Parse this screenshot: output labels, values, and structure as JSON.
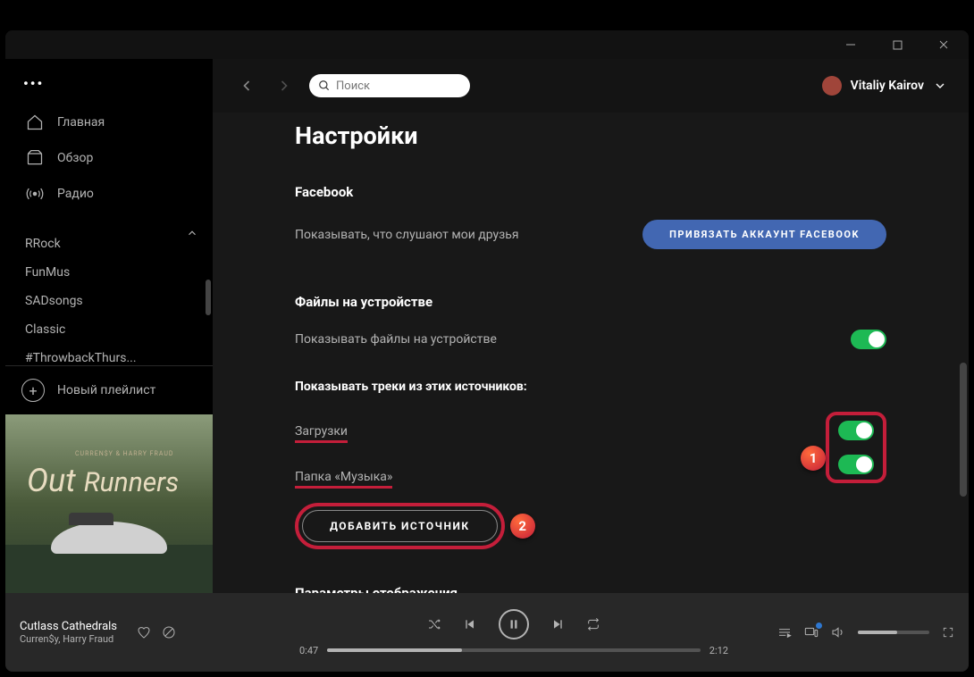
{
  "window": {
    "minimize": "−",
    "maximize": "☐",
    "close": "✕"
  },
  "search": {
    "placeholder": "Поиск"
  },
  "user": {
    "name": "Vitaliy Kairov"
  },
  "nav": {
    "more": "•••",
    "home": "Главная",
    "browse": "Обзор",
    "radio": "Радио"
  },
  "playlists": [
    "RRock",
    "FunMus",
    "SADsongs",
    "Classic",
    "#ThrowbackThurs..."
  ],
  "newPlaylist": "Новый плейлист",
  "album": {
    "topline": "CURREN$Y & HARRY FRAUD",
    "title_a": "Out",
    "title_b": "Runners"
  },
  "settings": {
    "title": "Настройки",
    "facebook": {
      "heading": "Facebook",
      "desc": "Показывать, что слушают мои друзья",
      "button": "ПРИВЯЗАТЬ АККАУНТ FACEBOOK"
    },
    "localFiles": {
      "heading": "Файлы на устройстве",
      "show": "Показывать файлы на устройстве",
      "sourcesLabel": "Показывать треки из этих источников:",
      "source1": "Загрузки",
      "source2": "Папка «Музыка»",
      "addSource": "ДОБАВИТЬ ИСТОЧНИК"
    },
    "display": {
      "heading": "Параметры отображения"
    },
    "markers": {
      "one": "1",
      "two": "2"
    }
  },
  "player": {
    "track": "Cutlass Cathedrals",
    "artist": "Curren$y, Harry Fraud",
    "elapsed": "0:47",
    "total": "2:12"
  }
}
